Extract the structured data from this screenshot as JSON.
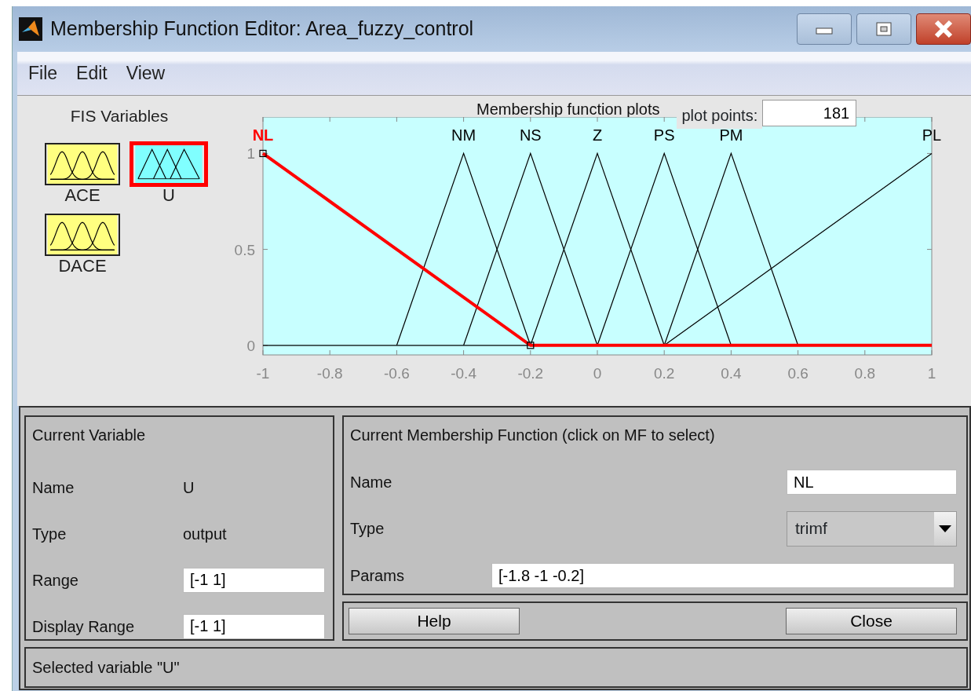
{
  "window": {
    "title": "Membership Function Editor: Area_fuzzy_control"
  },
  "menu": [
    "File",
    "Edit",
    "View"
  ],
  "fis_variables": {
    "heading": "FIS Variables",
    "items": [
      {
        "name": "ACE",
        "kind": "input",
        "selected": false
      },
      {
        "name": "U",
        "kind": "output",
        "selected": true
      },
      {
        "name": "DACE",
        "kind": "input",
        "selected": false
      }
    ]
  },
  "plot": {
    "plot_points_label": "plot points:",
    "plot_points": "181",
    "curves": [
      {
        "selected": true
      },
      {
        "selected": false
      },
      {
        "selected": false
      },
      {
        "selected": false
      },
      {
        "selected": false
      },
      {
        "selected": false
      },
      {
        "selected": false
      }
    ],
    "chart_data": {
      "type": "line",
      "title": "Membership function plots",
      "x": [
        -1,
        -0.8,
        -0.6,
        -0.4,
        -0.2,
        0,
        0.2,
        0.4,
        0.6,
        0.8,
        1
      ],
      "series": [
        {
          "name": "NL",
          "color": "#ff0000",
          "values": [
            1,
            0.75,
            0.5,
            0.25,
            0,
            0,
            0,
            0,
            0,
            0,
            0
          ]
        },
        {
          "name": "NM",
          "color": "#000000",
          "values": [
            null,
            null,
            0,
            1,
            0,
            null,
            null,
            null,
            null,
            null,
            null
          ]
        },
        {
          "name": "NS",
          "color": "#000000",
          "values": [
            null,
            null,
            null,
            0,
            1,
            0,
            null,
            null,
            null,
            null,
            null
          ]
        },
        {
          "name": "Z",
          "color": "#000000",
          "values": [
            null,
            null,
            null,
            null,
            0,
            1,
            0,
            null,
            null,
            null,
            null
          ]
        },
        {
          "name": "PS",
          "color": "#000000",
          "values": [
            null,
            null,
            null,
            null,
            null,
            0,
            1,
            0,
            null,
            null,
            null
          ]
        },
        {
          "name": "PM",
          "color": "#000000",
          "values": [
            null,
            null,
            null,
            null,
            null,
            null,
            0,
            1,
            0,
            null,
            null
          ]
        },
        {
          "name": "PL",
          "color": "#000000",
          "values": [
            null,
            null,
            null,
            null,
            null,
            null,
            0,
            0.25,
            0.5,
            0.75,
            1
          ]
        }
      ],
      "xlim": [
        -1,
        1
      ],
      "ylim": [
        -0.05,
        1.19
      ],
      "xticks": [
        -1,
        -0.8,
        -0.6,
        -0.4,
        -0.2,
        0,
        0.2,
        0.4,
        0.6,
        0.8,
        1
      ],
      "yticks": [
        0,
        0.5,
        1
      ]
    }
  },
  "current_variable": {
    "heading": "Current Variable",
    "fields": [
      {
        "label": "Name",
        "value": "U",
        "kind": "text"
      },
      {
        "label": "Type",
        "value": "output",
        "kind": "text"
      },
      {
        "label": "Range",
        "value": "[-1 1]",
        "kind": "input"
      },
      {
        "label": "Display Range",
        "value": "[-1 1]",
        "kind": "input"
      }
    ]
  },
  "current_mf": {
    "heading": "Current Membership Function (click on MF to select)",
    "name_label": "Name",
    "name": "NL",
    "type_label": "Type",
    "type": "trimf",
    "params_label": "Params",
    "params": "[-1.8 -1 -0.2]"
  },
  "buttons": [
    "Help",
    "Close"
  ],
  "status": "Selected variable \"U\""
}
